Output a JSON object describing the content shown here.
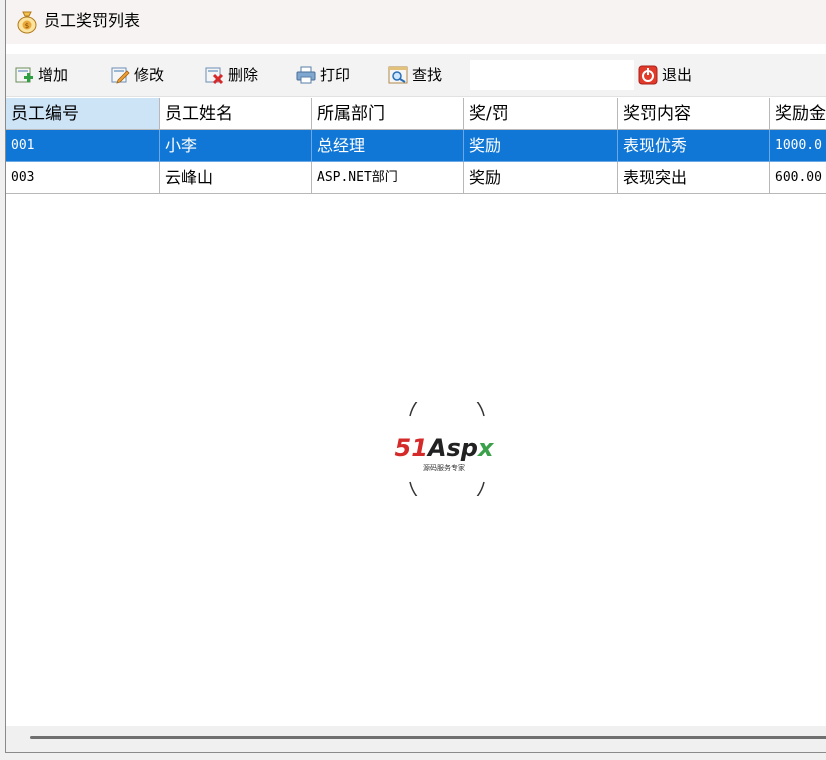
{
  "window": {
    "title": "员工奖罚列表"
  },
  "toolbar": {
    "add": "增加",
    "edit": "修改",
    "delete": "删除",
    "print": "打印",
    "find": "查找",
    "search_value": "",
    "exit": "退出"
  },
  "table": {
    "headers": [
      "员工编号",
      "员工姓名",
      "所属部门",
      "奖/罚",
      "奖罚内容",
      "奖励金"
    ],
    "rows": [
      [
        "001",
        "小李",
        "总经理",
        "奖励",
        "表现优秀",
        "1000.0"
      ],
      [
        "003",
        "云峰山",
        "ASP.NET部门",
        "奖励",
        "表现突出",
        "600.00"
      ]
    ]
  },
  "watermark": {
    "brand": "51Aspx",
    "tagline": "源码服务专家"
  },
  "colors": {
    "selection": "#1177d6",
    "header_active": "#cde4f7"
  }
}
